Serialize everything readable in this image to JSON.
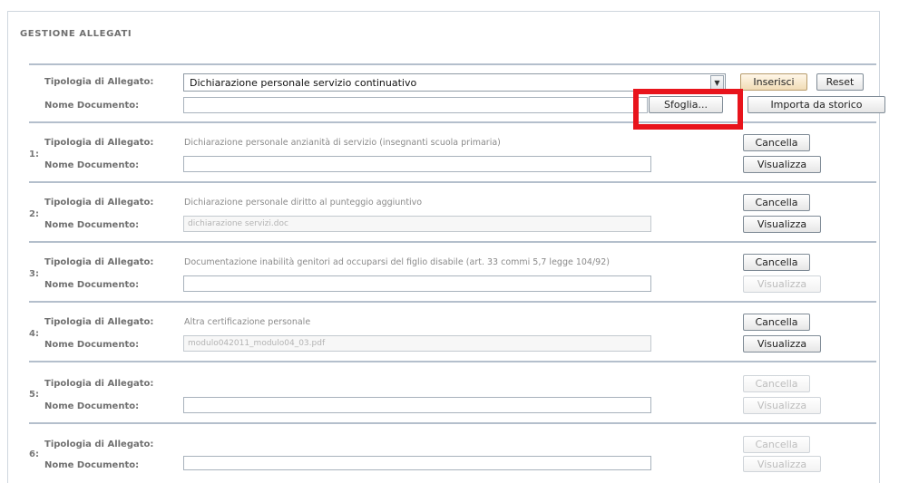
{
  "section": {
    "title": "GESTIONE ALLEGATI"
  },
  "labels": {
    "tipologia": "Tipologia di Allegato:",
    "nome": "Nome Documento:"
  },
  "new_attachment": {
    "selected_type": "Dichiarazione personale servizio continuativo",
    "select_arrow": "▼",
    "file_value": "",
    "buttons": {
      "inserisci": "Inserisci",
      "reset": "Reset",
      "sfoglia": "Sfoglia...",
      "importa": "Importa da storico"
    }
  },
  "rows": [
    {
      "index": "1:",
      "type": "Dichiarazione personale anzianità di servizio (insegnanti scuola primaria)",
      "document": "",
      "cancella": "Cancella",
      "visualizza": "Visualizza"
    },
    {
      "index": "2:",
      "type": "Dichiarazione personale diritto al punteggio aggiuntivo",
      "document": "dichiarazione servizi.doc",
      "cancella": "Cancella",
      "visualizza": "Visualizza"
    },
    {
      "index": "3:",
      "type": "Documentazione inabilità genitori ad occuparsi del figlio disabile (art. 33 commi 5,7 legge 104/92)",
      "document": "",
      "cancella": "Cancella",
      "visualizza": "Visualizza"
    },
    {
      "index": "4:",
      "type": "Altra certificazione personale",
      "document": "modulo042011_modulo04_03.pdf",
      "cancella": "Cancella",
      "visualizza": "Visualizza"
    },
    {
      "index": "5:",
      "type": "",
      "document": "",
      "cancella": "Cancella",
      "visualizza": "Visualizza"
    },
    {
      "index": "6:",
      "type": "",
      "document": "",
      "cancella": "Cancella",
      "visualizza": "Visualizza"
    }
  ],
  "colors": {
    "highlight": "#e8141c",
    "separator": "#b4bfcc"
  }
}
